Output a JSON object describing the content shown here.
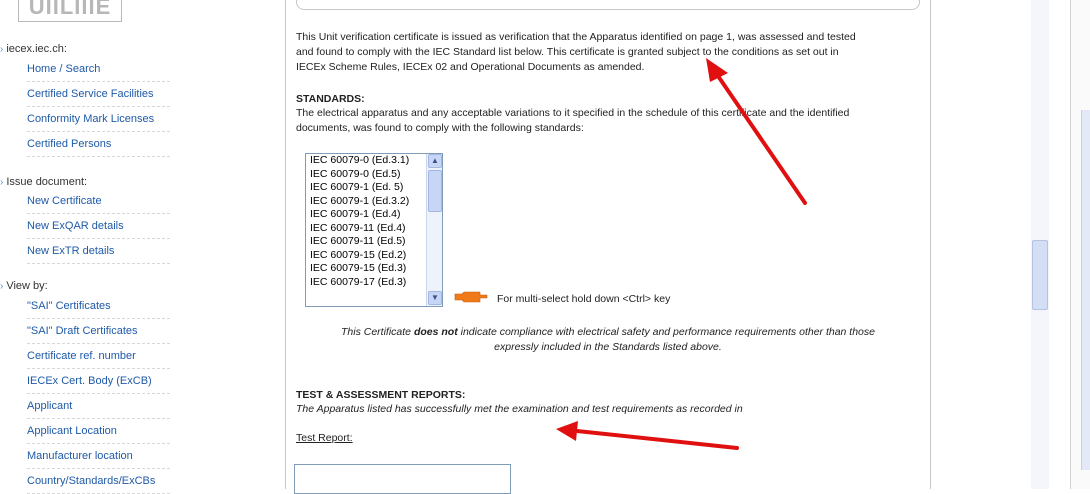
{
  "sidebar": {
    "logo_text": "UIILIIIE",
    "group_iecex": "iecex.iec.ch:",
    "links_iecex": [
      "Home / Search",
      "Certified Service Facilities",
      "Conformity Mark Licenses",
      "Certified Persons"
    ],
    "group_issue": "Issue document:",
    "links_issue": [
      "New Certificate",
      "New ExQAR details",
      "New ExTR details"
    ],
    "group_view": "View by:",
    "links_view": [
      "\"SAI\" Certificates",
      "\"SAI\" Draft Certificates",
      "Certificate ref. number",
      "IECEx Cert. Body (ExCB)",
      "Applicant",
      "Applicant Location",
      "Manufacturer location",
      "Country/Standards/ExCBs"
    ]
  },
  "main": {
    "intro_line1": "This Unit verification certificate is issued as verification that the Apparatus identified on page 1, was assessed and tested",
    "intro_line2": "and found to comply with the IEC Standard list below. This certificate is granted subject to the conditions as set out in",
    "intro_line3": "IECEx Scheme Rules, IECEx 02 and Operational Documents as amended.",
    "standards_heading": "STANDARDS:",
    "standards_line1": "The electrical apparatus and any acceptable variations to it specified in the schedule of this certificate and the identified",
    "standards_line2": "documents, was found to comply with the following standards:",
    "standards_list": [
      "IEC 60079-0 (Ed.3.1)",
      "IEC 60079-0 (Ed.5)",
      "IEC 60079-1 (Ed. 5)",
      "IEC 60079-1 (Ed.3.2)",
      "IEC 60079-1 (Ed.4)",
      "IEC 60079-11 (Ed.4)",
      "IEC 60079-11 (Ed.5)",
      "IEC 60079-15 (Ed.2)",
      "IEC 60079-15 (Ed.3)",
      "IEC 60079-17 (Ed.3)"
    ],
    "multiselect_hint": "For multi-select hold down <Ctrl> key",
    "disclaimer_pre": "This Certificate ",
    "disclaimer_bold": "does not",
    "disclaimer_post": " indicate compliance with electrical safety and performance requirements other than those",
    "disclaimer_line2": "expressly included in the Standards listed above.",
    "reports_heading": "TEST & ASSESSMENT REPORTS:",
    "reports_line": "The Apparatus listed has successfully met the examination and test requirements as recorded in",
    "test_report_label": "Test Report:"
  },
  "colors": {
    "link": "#1e5aa8",
    "annotation_arrow": "#e01010",
    "hand_icon": "#f07a1a"
  },
  "icons": {
    "pointing_hand": "pointing-hand-icon",
    "scroll_up": "scroll-up-icon",
    "scroll_down": "scroll-down-icon"
  }
}
